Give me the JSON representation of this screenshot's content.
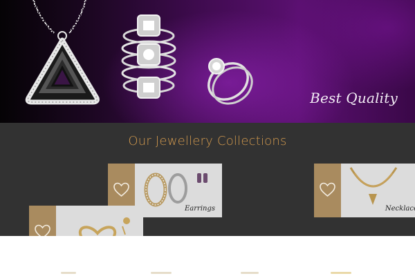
{
  "hero": {
    "caption": "Best Quality",
    "images": [
      "pendant-image",
      "ring-stack-image",
      "engagement-ring-image"
    ]
  },
  "collections": {
    "title": "Our Jewellery Collections",
    "cards": [
      {
        "label": "Earrings",
        "icon": "heart-icon"
      },
      {
        "label": "Necklaces",
        "icon": "heart-icon"
      },
      {
        "label": "",
        "icon": "heart-icon"
      }
    ]
  },
  "colors": {
    "hero_purple": "#5a1070",
    "section_bg": "#323232",
    "title_gold": "#d39a4e",
    "card_tab": "#a98b5f"
  }
}
